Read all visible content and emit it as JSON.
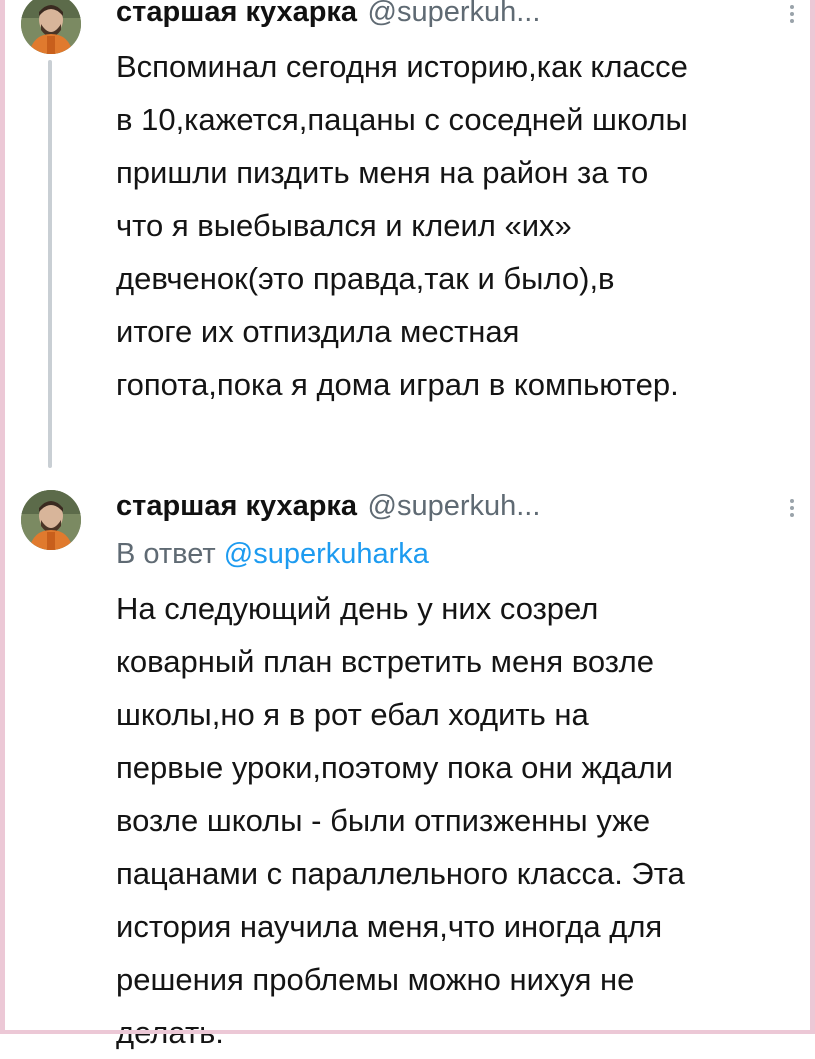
{
  "tweets": [
    {
      "author_name": "старшая кухарка",
      "author_handle": "@superkuh...",
      "text_lines": [
        "Вспоминал сегодня историю,как классе",
        "в 10,кажется,пацаны с соседней школы",
        "пришли пиздить меня на район за то",
        "что я выебывался и клеил «их»",
        "девченок(это правда,так и было),в",
        "итоге их отпиздила местная",
        "гопота,пока я дома играл в компьютер."
      ]
    },
    {
      "author_name": "старшая кухарка",
      "author_handle": "@superkuh...",
      "reply_prefix": "В ответ",
      "reply_mention": "@superkuharka",
      "text_lines": [
        "На следующий день у них созрел",
        "коварный план встретить меня возле",
        "школы,но я в рот ебал ходить на",
        "первые уроки,поэтому пока они ждали",
        "возле школы - были отпизженны уже",
        "пацанами с параллельного класса. Эта",
        "история научила меня,что иногда для",
        "решения проблемы можно нихуя не",
        "делать."
      ]
    }
  ],
  "icons": {
    "avatar": "avatar-icon",
    "more": "more-options-icon"
  },
  "colors": {
    "handle": "#5f6a73",
    "mention": "#1d9bf0",
    "thread_line": "#c9cfd4",
    "frame": "#ecc8d6"
  }
}
